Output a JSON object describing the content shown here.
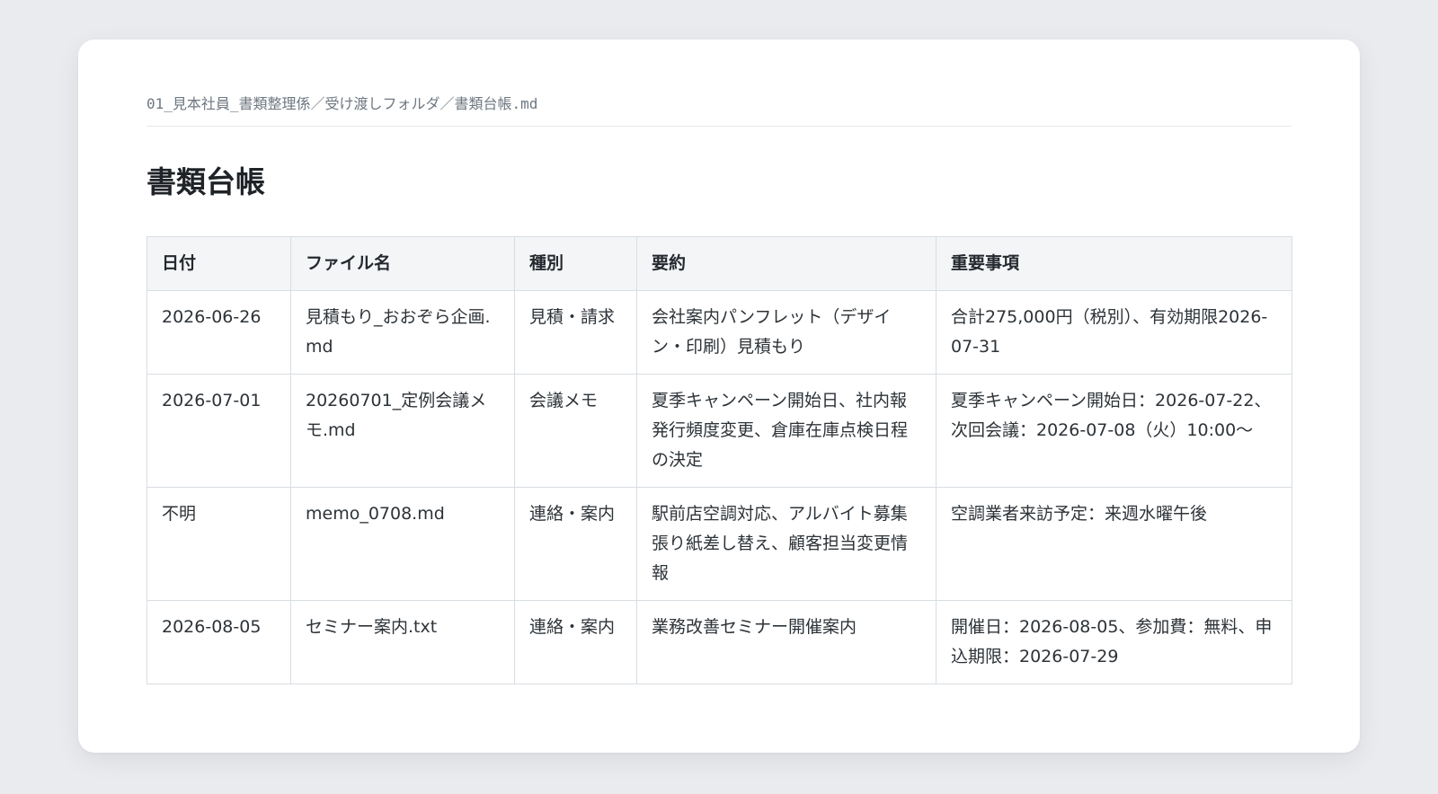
{
  "document": {
    "path": "01_見本社員_書類整理係／受け渡しフォルダ／書類台帳.md",
    "title": "書類台帳"
  },
  "table": {
    "headers": [
      "日付",
      "ファイル名",
      "種別",
      "要約",
      "重要事項"
    ],
    "rows": [
      [
        "2026-06-26",
        "見積もり_おおぞら企画.md",
        "見積・請求",
        "会社案内パンフレット（デザイン・印刷）見積もり",
        "合計275,000円（税別）、有効期限2026-07-31"
      ],
      [
        "2026-07-01",
        "20260701_定例会議メモ.md",
        "会議メモ",
        "夏季キャンペーン開始日、社内報発行頻度変更、倉庫在庫点検日程の決定",
        "夏季キャンペーン開始日：2026-07-22、次回会議：2026-07-08（火）10:00〜"
      ],
      [
        "不明",
        "memo_0708.md",
        "連絡・案内",
        "駅前店空調対応、アルバイト募集張り紙差し替え、顧客担当変更情報",
        "空調業者来訪予定：来週水曜午後"
      ],
      [
        "2026-08-05",
        "セミナー案内.txt",
        "連絡・案内",
        "業務改善セミナー開催案内",
        "開催日：2026-08-05、参加費：無料、申込期限：2026-07-29"
      ]
    ]
  }
}
